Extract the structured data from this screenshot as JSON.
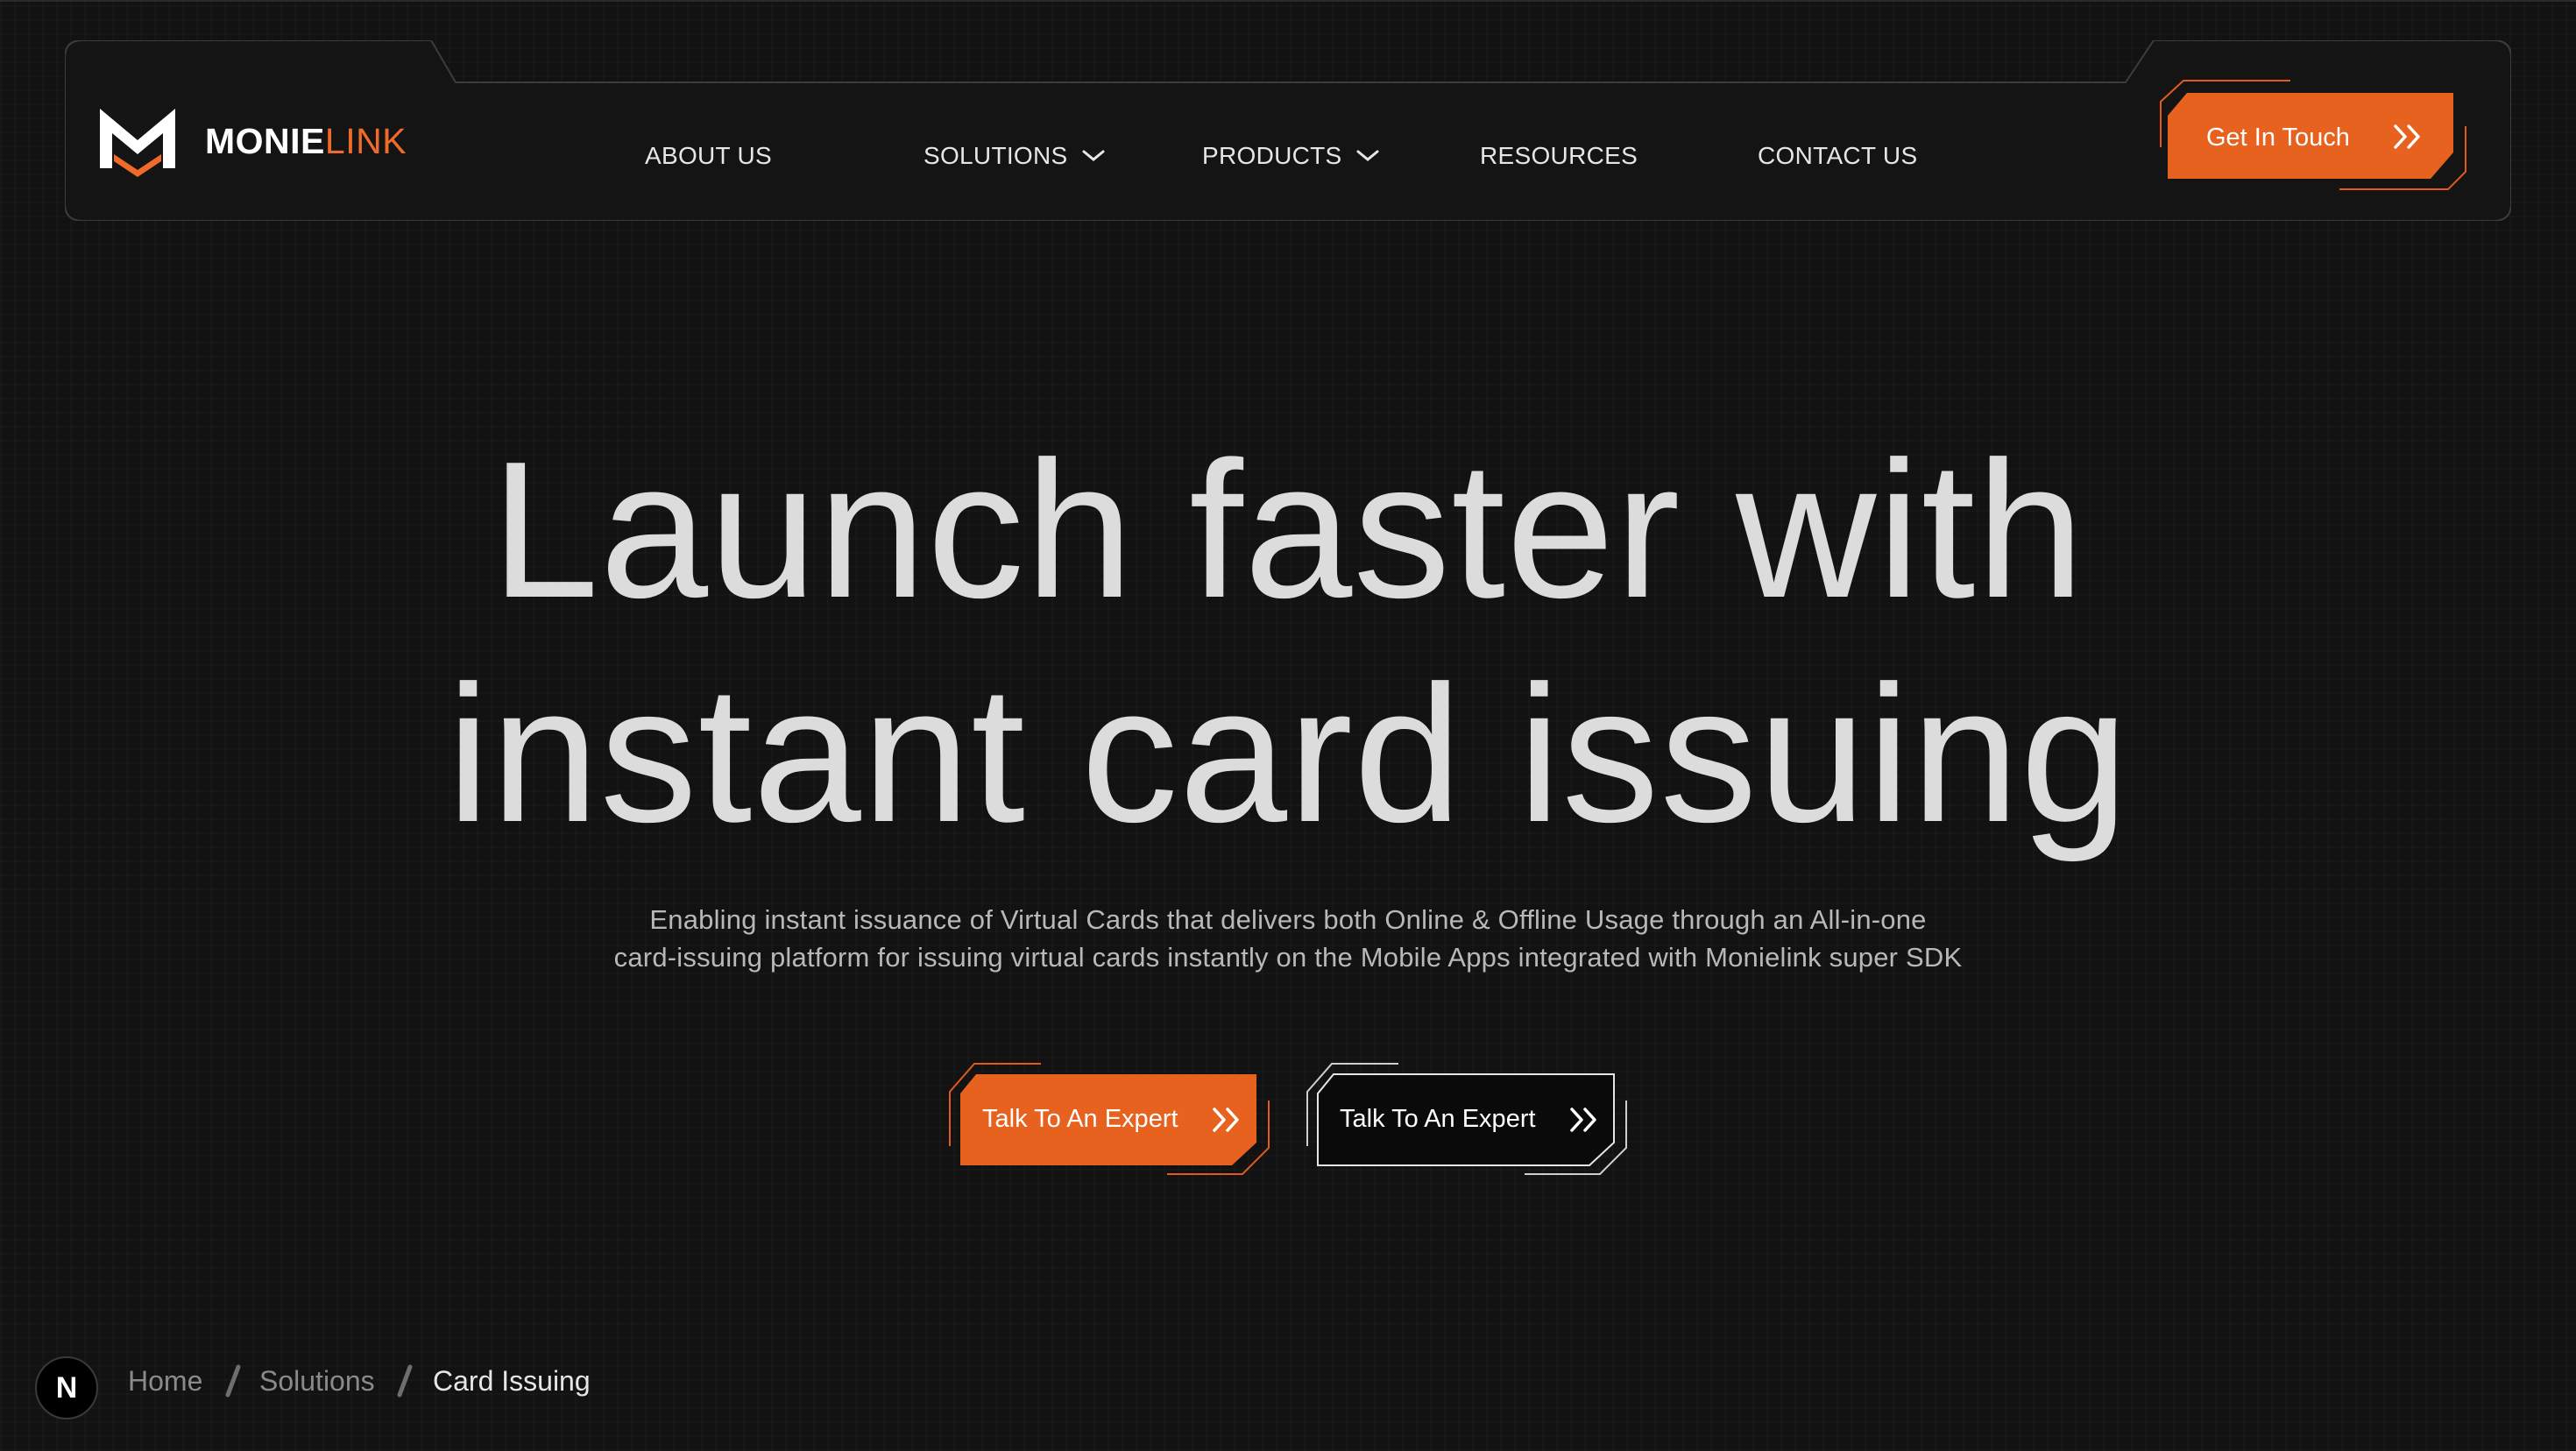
{
  "brand": {
    "name_bold": "MONIE",
    "name_light": "LINK",
    "logo_icon": "monielink-m-logo"
  },
  "nav": {
    "items": [
      {
        "label": "ABOUT US"
      },
      {
        "label": "SOLUTIONS",
        "dropdown": true
      },
      {
        "label": "PRODUCTS",
        "dropdown": true
      },
      {
        "label": "RESOURCES"
      },
      {
        "label": "CONTACT US"
      }
    ],
    "cta_label": "Get In Touch"
  },
  "hero": {
    "title_line1": "Launch faster with",
    "title_line2": "instant card issuing",
    "subtitle_line1": "Enabling instant issuance of Virtual Cards that delivers both Online & Offline Usage through an All-in-one",
    "subtitle_line2": "card-issuing platform for issuing virtual cards instantly on the Mobile Apps integrated with Monielink super SDK",
    "primary_cta": "Talk To An Expert",
    "secondary_cta": "Talk To An Expert"
  },
  "breadcrumb": {
    "badge": "N",
    "items": [
      "Home",
      "Solutions",
      "Card Issuing"
    ]
  },
  "colors": {
    "background": "#121212",
    "accent": "#f06a2a",
    "accent_dark": "#e25a1c",
    "text": "#dcdcdc"
  }
}
